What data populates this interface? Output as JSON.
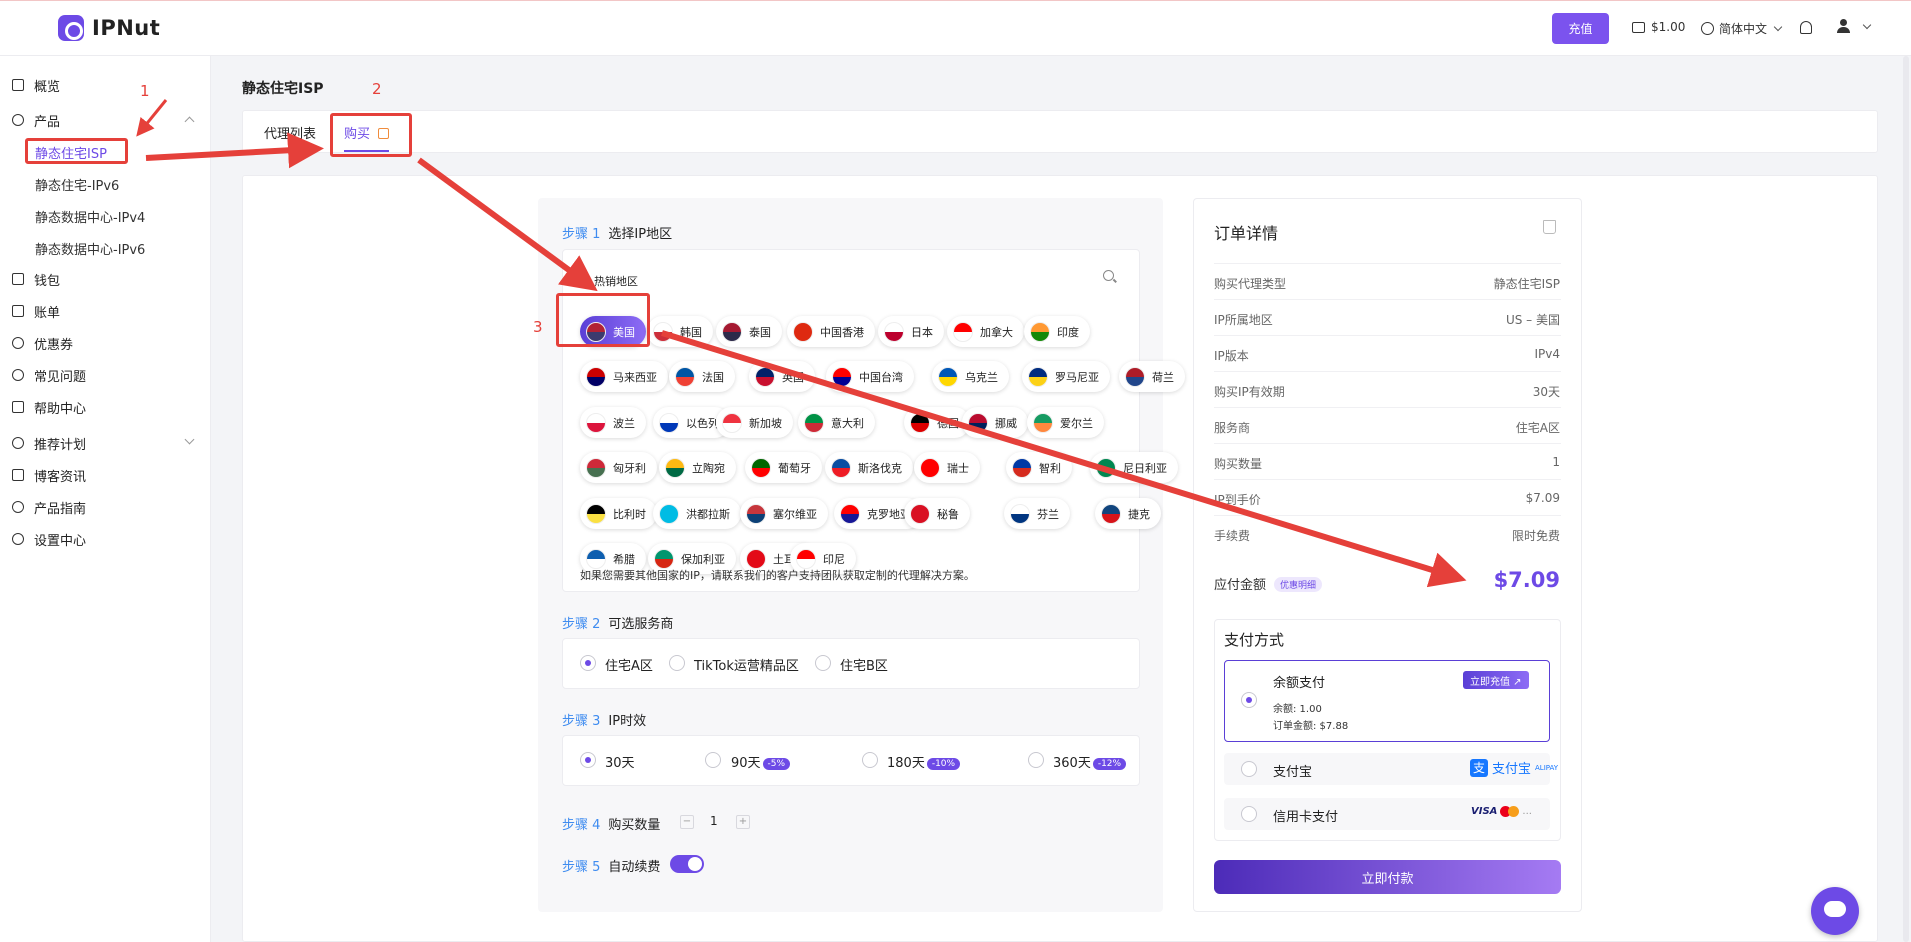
{
  "brand": {
    "name": "IPNut"
  },
  "header": {
    "recharge_label": "充值",
    "balance": "$1.00",
    "language": "简体中文"
  },
  "sidebar": {
    "items": [
      {
        "label": "概览"
      },
      {
        "label": "产品"
      },
      {
        "label": "钱包"
      },
      {
        "label": "账单"
      },
      {
        "label": "优惠券"
      },
      {
        "label": "常见问题"
      },
      {
        "label": "帮助中心"
      },
      {
        "label": "推荐计划"
      },
      {
        "label": "博客资讯"
      },
      {
        "label": "产品指南"
      },
      {
        "label": "设置中心"
      }
    ],
    "sub_items": [
      {
        "label": "静态住宅ISP"
      },
      {
        "label": "静态住宅-IPv6"
      },
      {
        "label": "静态数据中心-IPv4"
      },
      {
        "label": "静态数据中心-IPv6"
      }
    ]
  },
  "page": {
    "title": "静态住宅ISP",
    "tabs": [
      {
        "label": "代理列表"
      },
      {
        "label": "购买"
      }
    ]
  },
  "steps": {
    "step1": {
      "num": "步骤 1",
      "label": "选择IP地区"
    },
    "step2": {
      "num": "步骤 2",
      "label": "可选服务商"
    },
    "step3": {
      "num": "步骤 3",
      "label": "IP时效"
    },
    "step4": {
      "num": "步骤 4",
      "label": "购买数量"
    },
    "step5": {
      "num": "步骤 5",
      "label": "自动续费"
    }
  },
  "regions": {
    "hot_title": "热销地区",
    "countries": [
      {
        "name": "美国",
        "colors": [
          "#b22234",
          "#3c3b6e"
        ]
      },
      {
        "name": "韩国",
        "colors": [
          "#ffffff",
          "#cd2e3a"
        ]
      },
      {
        "name": "泰国",
        "colors": [
          "#a51931",
          "#2d2a4a"
        ]
      },
      {
        "name": "中国香港",
        "colors": [
          "#de2910",
          "#de2910"
        ]
      },
      {
        "name": "日本",
        "colors": [
          "#ffffff",
          "#bc002d"
        ]
      },
      {
        "name": "加拿大",
        "colors": [
          "#ff0000",
          "#ffffff"
        ]
      },
      {
        "name": "印度",
        "colors": [
          "#ff9933",
          "#138808"
        ]
      },
      {
        "name": "马来西亚",
        "colors": [
          "#cc0001",
          "#010066"
        ]
      },
      {
        "name": "法国",
        "colors": [
          "#0055a4",
          "#ef4135"
        ]
      },
      {
        "name": "英国",
        "colors": [
          "#012169",
          "#c8102e"
        ]
      },
      {
        "name": "中国台湾",
        "colors": [
          "#fe0000",
          "#000095"
        ]
      },
      {
        "name": "乌克兰",
        "colors": [
          "#0057b7",
          "#ffd700"
        ]
      },
      {
        "name": "罗马尼亚",
        "colors": [
          "#002b7f",
          "#fcd116"
        ]
      },
      {
        "name": "荷兰",
        "colors": [
          "#ae1c28",
          "#21468b"
        ]
      },
      {
        "name": "波兰",
        "colors": [
          "#ffffff",
          "#dc143c"
        ]
      },
      {
        "name": "以色列",
        "colors": [
          "#ffffff",
          "#0038b8"
        ]
      },
      {
        "name": "新加坡",
        "colors": [
          "#ef3340",
          "#ffffff"
        ]
      },
      {
        "name": "意大利",
        "colors": [
          "#009246",
          "#ce2b37"
        ]
      },
      {
        "name": "德国",
        "colors": [
          "#000000",
          "#dd0000"
        ]
      },
      {
        "name": "挪威",
        "colors": [
          "#ba0c2f",
          "#00205b"
        ]
      },
      {
        "name": "爱尔兰",
        "colors": [
          "#169b62",
          "#ff883e"
        ]
      },
      {
        "name": "匈牙利",
        "colors": [
          "#ce2939",
          "#477050"
        ]
      },
      {
        "name": "立陶宛",
        "colors": [
          "#fdb913",
          "#006a44"
        ]
      },
      {
        "name": "葡萄牙",
        "colors": [
          "#006600",
          "#ff0000"
        ]
      },
      {
        "name": "斯洛伐克",
        "colors": [
          "#0b4ea2",
          "#ee1c25"
        ]
      },
      {
        "name": "瑞士",
        "colors": [
          "#ff0000",
          "#ff0000"
        ]
      },
      {
        "name": "智利",
        "colors": [
          "#0039a6",
          "#d52b1e"
        ]
      },
      {
        "name": "尼日利亚",
        "colors": [
          "#008751",
          "#008751"
        ]
      },
      {
        "name": "比利时",
        "colors": [
          "#000000",
          "#fae042"
        ]
      },
      {
        "name": "洪都拉斯",
        "colors": [
          "#00bce4",
          "#00bce4"
        ]
      },
      {
        "name": "塞尔维亚",
        "colors": [
          "#c6363c",
          "#0c4076"
        ]
      },
      {
        "name": "克罗地亚",
        "colors": [
          "#ff0000",
          "#171796"
        ]
      },
      {
        "name": "秘鲁",
        "colors": [
          "#d91023",
          "#d91023"
        ]
      },
      {
        "name": "芬兰",
        "colors": [
          "#ffffff",
          "#003580"
        ]
      },
      {
        "name": "捷克",
        "colors": [
          "#11457e",
          "#d7141a"
        ]
      },
      {
        "name": "希腊",
        "colors": [
          "#0d5eaf",
          "#ffffff"
        ]
      },
      {
        "name": "保加利亚",
        "colors": [
          "#00966e",
          "#d62612"
        ]
      },
      {
        "name": "土耳其",
        "colors": [
          "#e30a17",
          "#e30a17"
        ]
      },
      {
        "name": "印尼",
        "colors": [
          "#ff0000",
          "#ffffff"
        ]
      }
    ],
    "note": "如果您需要其他国家的IP，请联系我们的客户支持团队获取定制的代理解决方案。"
  },
  "providers": [
    {
      "label": "住宅A区",
      "checked": true
    },
    {
      "label": "TikTok运营精品区",
      "checked": false
    },
    {
      "label": "住宅B区",
      "checked": false
    }
  ],
  "durations": [
    {
      "label": "30天",
      "discount": "",
      "checked": true
    },
    {
      "label": "90天",
      "discount": "-5%",
      "checked": false
    },
    {
      "label": "180天",
      "discount": "-10%",
      "checked": false
    },
    {
      "label": "360天",
      "discount": "-12%",
      "checked": false
    }
  ],
  "quantity": {
    "minus": "−",
    "value": "1",
    "plus": "+"
  },
  "auto_renew": true,
  "order": {
    "title": "订单详情",
    "rows": [
      {
        "label": "购买代理类型",
        "value": "静态住宅ISP"
      },
      {
        "label": "IP所属地区",
        "value": "US – 美国"
      },
      {
        "label": "IP版本",
        "value": "IPv4"
      },
      {
        "label": "购买IP有效期",
        "value": "30天"
      },
      {
        "label": "服务商",
        "value": "住宅A区"
      },
      {
        "label": "购买数量",
        "value": "1"
      },
      {
        "label": "IP到手价",
        "value": "$7.09"
      },
      {
        "label": "手续费",
        "value": "限时免费"
      }
    ],
    "total_label": "应付金额",
    "promo_label": "优惠明细",
    "total": "$7.09"
  },
  "payment": {
    "title": "支付方式",
    "balance_method": "余额支付",
    "recharge_now": "立即充值 ↗",
    "balance_info": "余额: 1.00",
    "order_amount": "订单金额: $7.88",
    "alipay": "支付宝",
    "alipay_logo": "支付宝",
    "alipay_sub": "ALIPAY",
    "card": "信用卡支付",
    "visa": "VISA",
    "more": "...",
    "pay_now": "立即付款"
  },
  "annotations": {
    "n1": "1",
    "n2": "2",
    "n3": "3",
    "color": "#e5403a"
  }
}
